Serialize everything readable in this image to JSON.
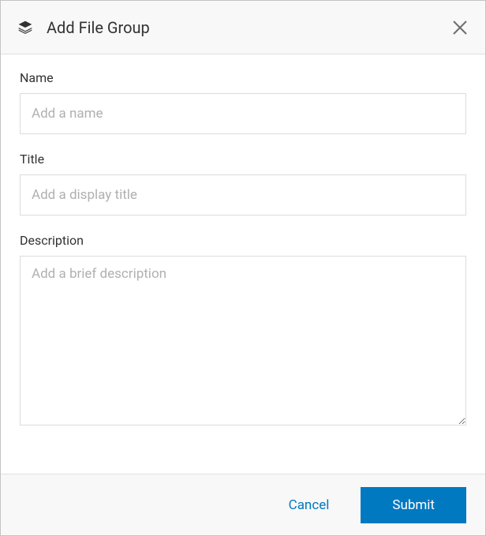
{
  "header": {
    "title": "Add File Group"
  },
  "form": {
    "name": {
      "label": "Name",
      "placeholder": "Add a name",
      "value": ""
    },
    "title": {
      "label": "Title",
      "placeholder": "Add a display title",
      "value": ""
    },
    "description": {
      "label": "Description",
      "placeholder": "Add a brief description",
      "value": ""
    }
  },
  "footer": {
    "cancel_label": "Cancel",
    "submit_label": "Submit"
  }
}
